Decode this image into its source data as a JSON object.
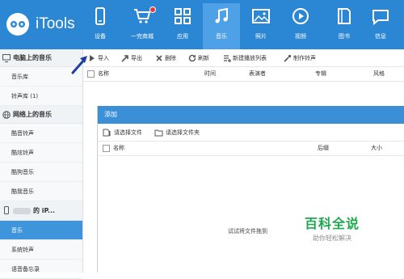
{
  "app": {
    "name": "iTools"
  },
  "nav": [
    {
      "label": "设备",
      "icon": "phone-icon"
    },
    {
      "label": "一完商城",
      "icon": "cart-icon"
    },
    {
      "label": "应用",
      "icon": "apps-icon"
    },
    {
      "label": "音乐",
      "icon": "music-icon"
    },
    {
      "label": "照片",
      "icon": "photo-icon"
    },
    {
      "label": "视频",
      "icon": "video-icon"
    },
    {
      "label": "图书",
      "icon": "book-icon"
    },
    {
      "label": "信息",
      "icon": "message-icon"
    }
  ],
  "sidebar": {
    "section1": "电脑上的音乐",
    "section1_items": [
      "音乐库",
      "铃声库 (1)"
    ],
    "section2": "网络上的音乐",
    "section2_items": [
      "酷音铃声",
      "酷炫铃声",
      "酷狗音乐",
      "酷我音乐"
    ],
    "section3": "的 iP...",
    "section3_items": [
      "音乐",
      "系统铃声",
      "语音备忘录"
    ]
  },
  "toolbar": {
    "import": "导入",
    "export": "导出",
    "delete": "删除",
    "refresh": "刷新",
    "new_playlist": "新建播放列表",
    "make_ringtone": "制作铃声"
  },
  "list_header": {
    "name": "名称",
    "time": "时间",
    "artist": "表演者",
    "album": "专辑",
    "style": "风格"
  },
  "dialog": {
    "title": "添加",
    "select_file": "请选择文件",
    "select_folder": "请选择文件夹",
    "col_name": "名称",
    "col_ext": "后缀",
    "col_size": "大小",
    "drop_hint": "试试将文件拖到"
  },
  "watermark": {
    "title": "百科全说",
    "subtitle": "助你轻松解决"
  },
  "colors": {
    "topbar": "#2b87d3",
    "active_nav": "#4ea1e6",
    "sidebar_active": "#3f95dc",
    "dialog_title": "#3b8fd6",
    "watermark": "#1fa84f"
  }
}
